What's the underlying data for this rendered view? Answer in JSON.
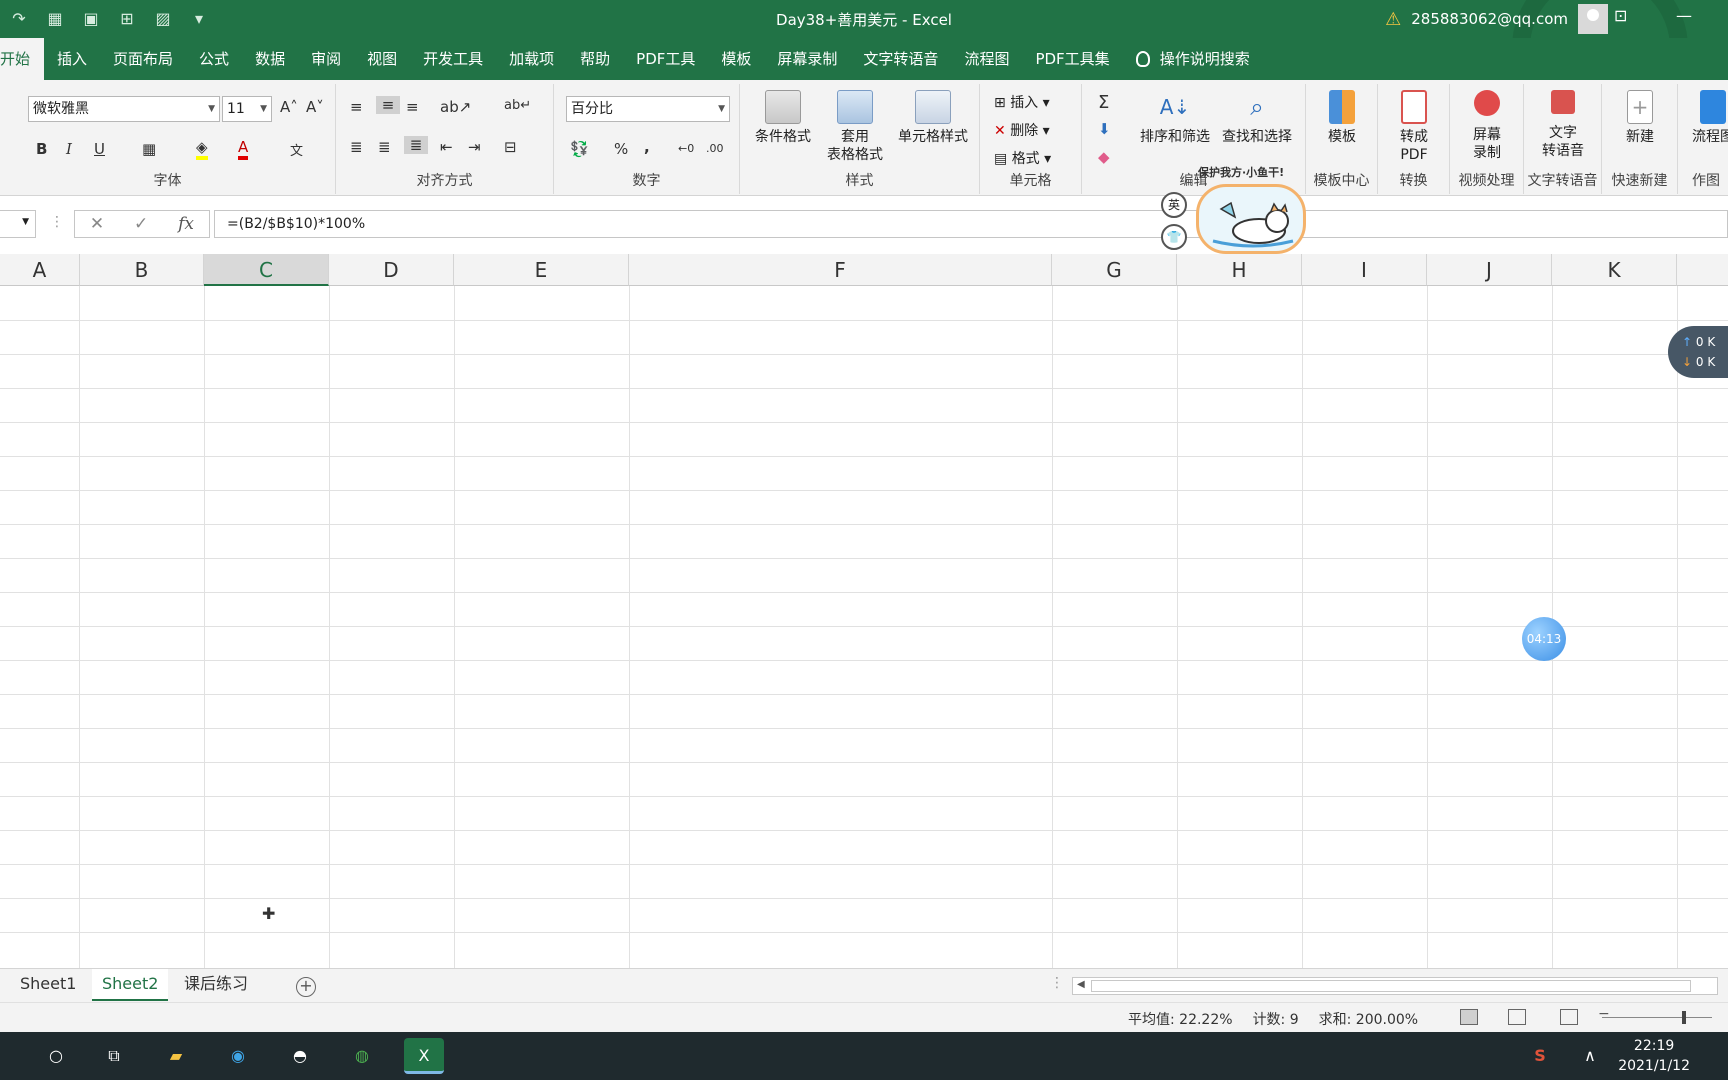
{
  "window": {
    "title": "Day38+善用美元  -  Excel",
    "account": "285883062@qq.com"
  },
  "tabs": [
    "开始",
    "插入",
    "页面布局",
    "公式",
    "数据",
    "审阅",
    "视图",
    "开发工具",
    "加载项",
    "帮助",
    "PDF工具",
    "模板",
    "屏幕录制",
    "文字转语音",
    "流程图",
    "PDF工具集",
    "操作说明搜索"
  ],
  "ribbon": {
    "font": {
      "name": "微软雅黑",
      "size": "11",
      "label": "字体",
      "bold": "B",
      "italic": "I",
      "underline": "U"
    },
    "alignment": {
      "label": "对齐方式"
    },
    "number": {
      "format": "百分比",
      "label": "数字",
      "percent": "%",
      "comma": ","
    },
    "styles": {
      "conditional": "条件格式",
      "table1": "套用",
      "table2": "表格格式",
      "cell": "单元格样式",
      "label": "样式"
    },
    "cells": {
      "insert": "插入",
      "delete": "删除",
      "format": "格式",
      "label": "单元格"
    },
    "editing": {
      "sort": "排序和筛选",
      "find": "查找和选择",
      "label": "编辑"
    },
    "template": {
      "button": "模板",
      "label": "模板中心"
    },
    "convert": {
      "button1": "转成",
      "button2": "PDF",
      "label": "转换"
    },
    "record": {
      "button1": "屏幕",
      "button2": "录制",
      "label": "视频处理"
    },
    "tts": {
      "button1": "文字",
      "button2": "转语音",
      "label": "文字转语音"
    },
    "new": {
      "button": "新建",
      "label": "快速新建"
    },
    "flow": {
      "button": "流程图",
      "label": "作图"
    }
  },
  "formula_bar": {
    "formula": "=(B2/$B$10)*100%",
    "fx": "fx"
  },
  "columns": [
    "A",
    "B",
    "C",
    "D",
    "E",
    "F",
    "G",
    "H",
    "I",
    "J",
    "K"
  ],
  "selected_column": "C",
  "sheets": [
    "Sheet1",
    "Sheet2",
    "课后练习"
  ],
  "active_sheet": "Sheet2",
  "status": {
    "average": "平均值: 22.22%",
    "count": "计数: 9",
    "sum": "求和: 200.00%"
  },
  "overlays": {
    "timer": "04:13",
    "pet_caption": "保护我方·小鱼干!",
    "pet_btn": "英",
    "net_up": "0 K",
    "net_down": "0 K"
  },
  "taskbar": {
    "time": "22:19",
    "date": "2021/1/12"
  },
  "colors": {
    "accent": "#217346"
  }
}
